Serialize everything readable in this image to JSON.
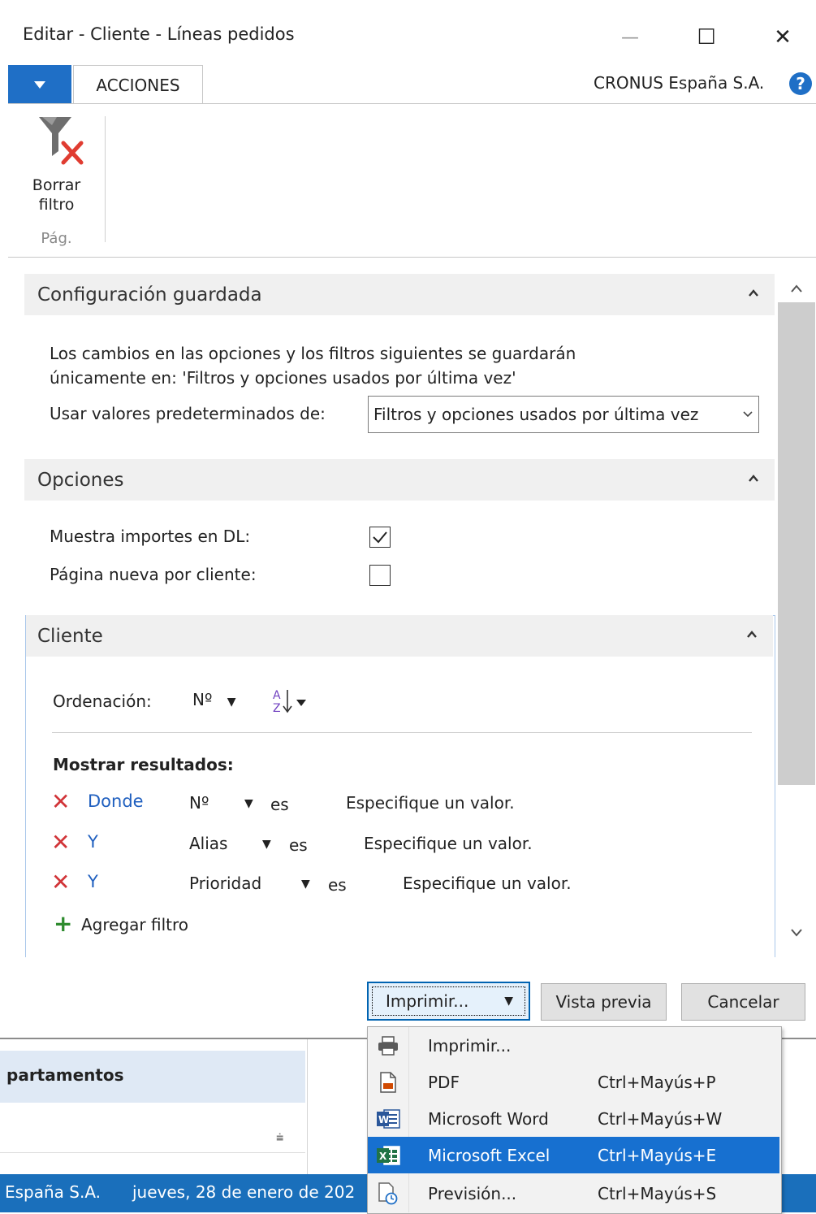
{
  "window": {
    "title": "Editar - Cliente - Líneas pedidos",
    "minimize": "—",
    "maximize": "☐",
    "close": "✕"
  },
  "ribbon": {
    "tab": "ACCIONES",
    "company": "CRONUS España S.A.",
    "help": "?",
    "clear_filter_line1": "Borrar",
    "clear_filter_line2": "filtro",
    "group_label": "Pág."
  },
  "saved_config": {
    "title": "Configuración guardada",
    "info_line1": "Los cambios en las opciones y los filtros siguientes se guardarán",
    "info_line2": "únicamente en: 'Filtros y opciones usados por última vez'",
    "defaults_label": "Usar valores predeterminados de:",
    "defaults_value": "Filtros y opciones usados por última vez"
  },
  "options": {
    "title": "Opciones",
    "show_amounts_label": "Muestra importes en DL:",
    "show_amounts_checked": true,
    "new_page_label": "Página nueva por cliente:",
    "new_page_checked": false
  },
  "cliente": {
    "title": "Cliente",
    "sort_label": "Ordenación:",
    "sort_field": "Nº",
    "show_results": "Mostrar resultados:",
    "filters": [
      {
        "conj": "Donde",
        "field": "Nº",
        "op": "es",
        "value": "Especifique un valor."
      },
      {
        "conj": "Y",
        "field": "Alias",
        "op": "es",
        "value": "Especifique un valor."
      },
      {
        "conj": "Y",
        "field": "Prioridad",
        "op": "es",
        "value": "Especifique un valor."
      }
    ],
    "add_filter": "Agregar filtro"
  },
  "buttons": {
    "print": "Imprimir...",
    "preview": "Vista previa",
    "cancel": "Cancelar"
  },
  "print_menu": [
    {
      "label": "Imprimir...",
      "shortcut": "",
      "icon": "printer-icon"
    },
    {
      "label": "PDF",
      "shortcut": "Ctrl+Mayús+P",
      "icon": "pdf-icon"
    },
    {
      "label": "Microsoft Word",
      "shortcut": "Ctrl+Mayús+W",
      "icon": "word-icon"
    },
    {
      "label": "Microsoft Excel",
      "shortcut": "Ctrl+Mayús+E",
      "icon": "excel-icon",
      "active": true
    },
    {
      "label": "Previsión...",
      "shortcut": "Ctrl+Mayús+S",
      "icon": "schedule-icon"
    }
  ],
  "background": {
    "header": "partamentos",
    "status_company": "España S.A.",
    "status_date": "jueves, 28 de enero de 202"
  },
  "colors": {
    "accent": "#1f6fc6",
    "status_bar": "#1a6fbb",
    "menu_highlight": "#1770d0",
    "delete_red": "#d13438",
    "add_green": "#2e8b2e"
  }
}
